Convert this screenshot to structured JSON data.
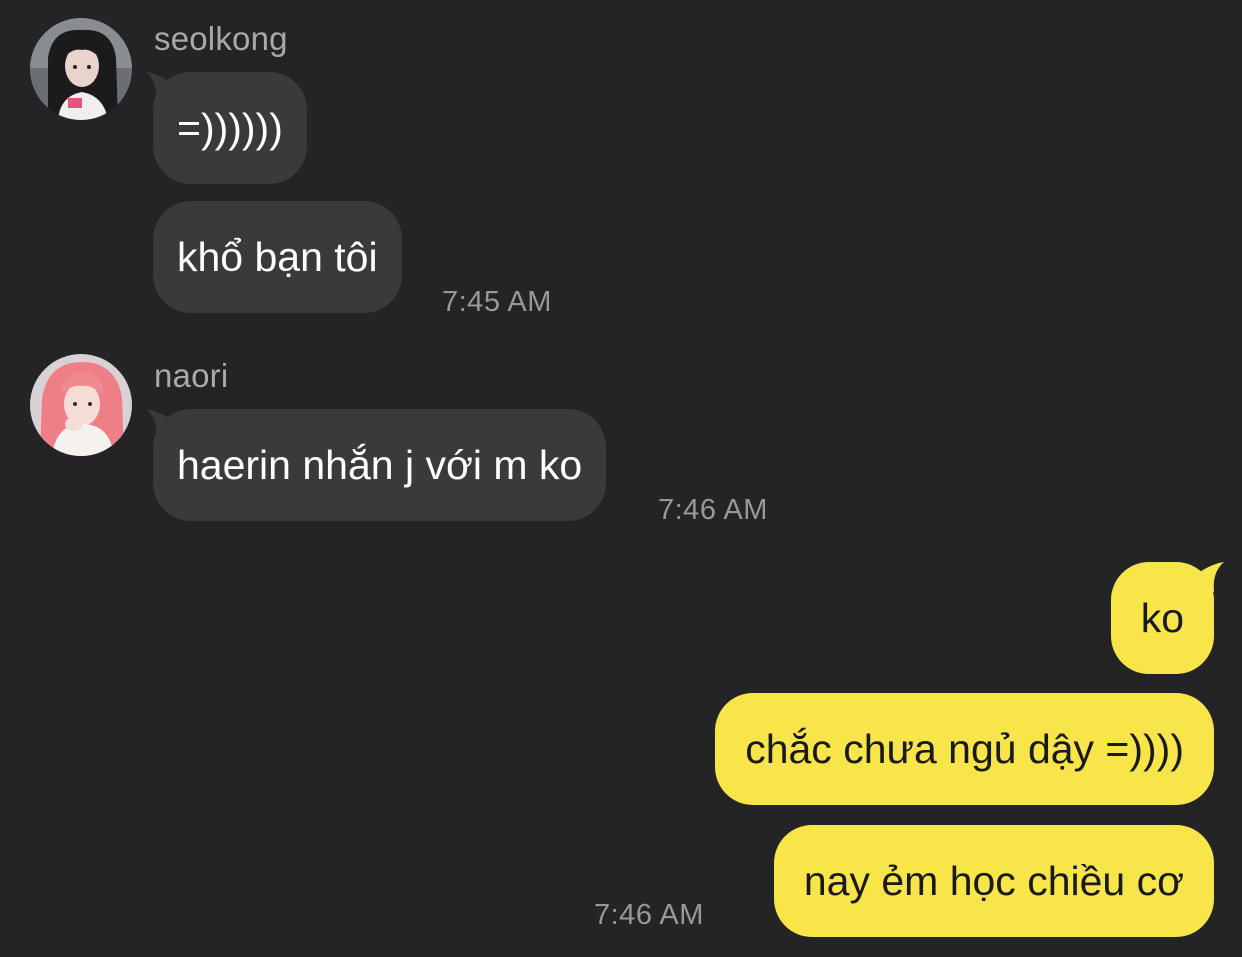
{
  "groups": [
    {
      "sender": "seolkong",
      "avatar_icon": "profile-photo-dark-hair",
      "messages": [
        "=))))))",
        "khổ bạn tôi"
      ],
      "time": "7:45 AM"
    },
    {
      "sender": "naori",
      "avatar_icon": "profile-photo-pink-hair",
      "messages": [
        "haerin nhắn j với m ko"
      ],
      "time": "7:46 AM"
    }
  ],
  "outgoing": {
    "messages": [
      "ko",
      "chắc chưa ngủ dậy =))))",
      "nay ẻm học chiều cơ"
    ],
    "time": "7:46 AM"
  },
  "colors": {
    "background": "#242426",
    "incoming_bubble": "#3a3a3d",
    "outgoing_bubble": "#f8e54a",
    "sender_text": "#a9a9ad",
    "timestamp_text": "#98989c"
  }
}
